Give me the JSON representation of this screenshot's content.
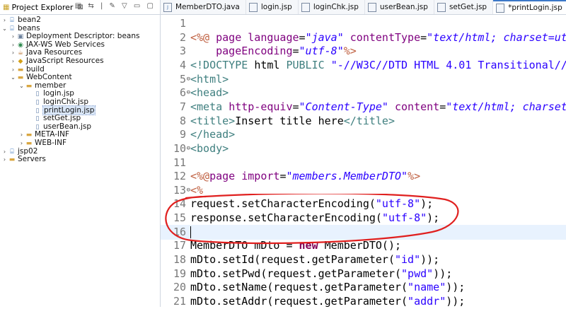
{
  "explorer": {
    "title": "Project Explorer",
    "close_glyph": "⊠",
    "toolbar_icons": "▤ ⇆ | ✎ ▽ ▭ ▢",
    "items": [
      {
        "label": "bean2",
        "indent": 0,
        "arrow": "›",
        "icon": "project-icon"
      },
      {
        "label": "beans",
        "indent": 0,
        "arrow": "⌄",
        "icon": "project-icon"
      },
      {
        "label": "Deployment Descriptor: beans",
        "indent": 1,
        "arrow": "›",
        "icon": "descriptor-icon"
      },
      {
        "label": "JAX-WS Web Services",
        "indent": 1,
        "arrow": "›",
        "icon": "webservice-icon"
      },
      {
        "label": "Java Resources",
        "indent": 1,
        "arrow": "›",
        "icon": "java-resources-icon"
      },
      {
        "label": "JavaScript Resources",
        "indent": 1,
        "arrow": "›",
        "icon": "js-resources-icon"
      },
      {
        "label": "build",
        "indent": 1,
        "arrow": "›",
        "icon": "folder-icon"
      },
      {
        "label": "WebContent",
        "indent": 1,
        "arrow": "⌄",
        "icon": "folder-icon"
      },
      {
        "label": "member",
        "indent": 2,
        "arrow": "⌄",
        "icon": "folder-icon"
      },
      {
        "label": "login.jsp",
        "indent": 3,
        "arrow": "",
        "icon": "jsp-file-icon"
      },
      {
        "label": "loginChk.jsp",
        "indent": 3,
        "arrow": "",
        "icon": "jsp-file-icon"
      },
      {
        "label": "printLogin.jsp",
        "indent": 3,
        "arrow": "",
        "icon": "jsp-file-icon",
        "selected": true
      },
      {
        "label": "setGet.jsp",
        "indent": 3,
        "arrow": "",
        "icon": "jsp-file-icon"
      },
      {
        "label": "userBean.jsp",
        "indent": 3,
        "arrow": "",
        "icon": "jsp-file-icon"
      },
      {
        "label": "META-INF",
        "indent": 2,
        "arrow": "›",
        "icon": "folder-icon"
      },
      {
        "label": "WEB-INF",
        "indent": 2,
        "arrow": "›",
        "icon": "folder-icon"
      },
      {
        "label": "jsp02",
        "indent": 0,
        "arrow": "›",
        "icon": "project-icon"
      },
      {
        "label": "Servers",
        "indent": 0,
        "arrow": "›",
        "icon": "folder-icon"
      }
    ]
  },
  "editor": {
    "tabs": [
      {
        "label": "MemberDTO.java",
        "icon": "J"
      },
      {
        "label": "login.jsp",
        "icon": ""
      },
      {
        "label": "loginChk.jsp",
        "icon": ""
      },
      {
        "label": "userBean.jsp",
        "icon": ""
      },
      {
        "label": "setGet.jsp",
        "icon": ""
      },
      {
        "label": "*printLogin.jsp",
        "icon": "",
        "active": true,
        "close": "⊠"
      }
    ],
    "lines": [
      {
        "n": "1",
        "fold": "",
        "parts": []
      },
      {
        "n": "2",
        "fold": "",
        "parts": [
          [
            "dir",
            "<%@ "
          ],
          [
            "attr",
            "page "
          ],
          [
            "attr",
            "language"
          ],
          [
            "tx",
            "="
          ],
          [
            "str",
            "\"java\""
          ],
          [
            "tx",
            " "
          ],
          [
            "attr",
            "contentType"
          ],
          [
            "tx",
            "="
          ],
          [
            "str",
            "\"text/html; charset=ut"
          ]
        ]
      },
      {
        "n": "3",
        "fold": "",
        "parts": [
          [
            "tx",
            "    "
          ],
          [
            "attr",
            "pageEncoding"
          ],
          [
            "tx",
            "="
          ],
          [
            "str",
            "\"utf-8\""
          ],
          [
            "dir",
            "%>"
          ]
        ]
      },
      {
        "n": "4",
        "fold": "",
        "parts": [
          [
            "tag",
            "<!DOCTYPE "
          ],
          [
            "tx",
            "html "
          ],
          [
            "tag",
            "PUBLIC "
          ],
          [
            "strn",
            "\"-//W3C//DTD HTML 4.01 Transitional//"
          ]
        ]
      },
      {
        "n": "5",
        "fold": "⊖",
        "parts": [
          [
            "tag",
            "<html>"
          ]
        ]
      },
      {
        "n": "6",
        "fold": "⊖",
        "parts": [
          [
            "tag",
            "<head>"
          ]
        ]
      },
      {
        "n": "7",
        "fold": "",
        "parts": [
          [
            "tag",
            "<meta "
          ],
          [
            "attr",
            "http-equiv"
          ],
          [
            "tx",
            "="
          ],
          [
            "str",
            "\"Content-Type\""
          ],
          [
            "tx",
            " "
          ],
          [
            "attr",
            "content"
          ],
          [
            "tx",
            "="
          ],
          [
            "str",
            "\"text/html; charset"
          ]
        ]
      },
      {
        "n": "8",
        "fold": "",
        "parts": [
          [
            "tag",
            "<title>"
          ],
          [
            "tx",
            "Insert title here"
          ],
          [
            "tag",
            "</title>"
          ]
        ]
      },
      {
        "n": "9",
        "fold": "",
        "parts": [
          [
            "tag",
            "</head>"
          ]
        ]
      },
      {
        "n": "10",
        "fold": "⊖",
        "parts": [
          [
            "tag",
            "<body>"
          ]
        ]
      },
      {
        "n": "11",
        "fold": "",
        "parts": []
      },
      {
        "n": "12",
        "fold": "",
        "parts": [
          [
            "dir",
            "<%@"
          ],
          [
            "attr",
            "page "
          ],
          [
            "attr",
            "import"
          ],
          [
            "tx",
            "="
          ],
          [
            "str",
            "\"members.MemberDTO\""
          ],
          [
            "dir",
            "%>"
          ]
        ]
      },
      {
        "n": "13",
        "fold": "⊖",
        "parts": [
          [
            "dir",
            "<%"
          ]
        ]
      },
      {
        "n": "14",
        "fold": "",
        "parts": [
          [
            "tx",
            "request.setCharacterEncoding("
          ],
          [
            "strn",
            "\"utf-8\""
          ],
          [
            "tx",
            ");"
          ]
        ]
      },
      {
        "n": "15",
        "fold": "",
        "parts": [
          [
            "tx",
            "response.setCharacterEncoding("
          ],
          [
            "strn",
            "\"utf-8\""
          ],
          [
            "tx",
            ");"
          ]
        ]
      },
      {
        "n": "16",
        "fold": "",
        "parts": [],
        "highlight": true,
        "cursor": true
      },
      {
        "n": "17",
        "fold": "",
        "parts": [
          [
            "tx",
            "MemberDTO mDto = "
          ],
          [
            "kw",
            "new"
          ],
          [
            "tx",
            " MemberDTO();"
          ]
        ]
      },
      {
        "n": "18",
        "fold": "",
        "parts": [
          [
            "tx",
            "mDto.setId(request.getParameter("
          ],
          [
            "strn",
            "\"id\""
          ],
          [
            "tx",
            "));"
          ]
        ]
      },
      {
        "n": "19",
        "fold": "",
        "parts": [
          [
            "tx",
            "mDto.setPwd(request.getParameter("
          ],
          [
            "strn",
            "\"pwd\""
          ],
          [
            "tx",
            "));"
          ]
        ]
      },
      {
        "n": "20",
        "fold": "",
        "parts": [
          [
            "tx",
            "mDto.setName(request.getParameter("
          ],
          [
            "strn",
            "\"name\""
          ],
          [
            "tx",
            "));"
          ]
        ]
      },
      {
        "n": "21",
        "fold": "",
        "parts": [
          [
            "tx",
            "mDto.setAddr(request.getParameter("
          ],
          [
            "strn",
            "\"addr\""
          ],
          [
            "tx",
            "));"
          ]
        ]
      }
    ]
  },
  "colors": {
    "annotation_oval": "#e0201f",
    "accent": "#3c78c8"
  }
}
